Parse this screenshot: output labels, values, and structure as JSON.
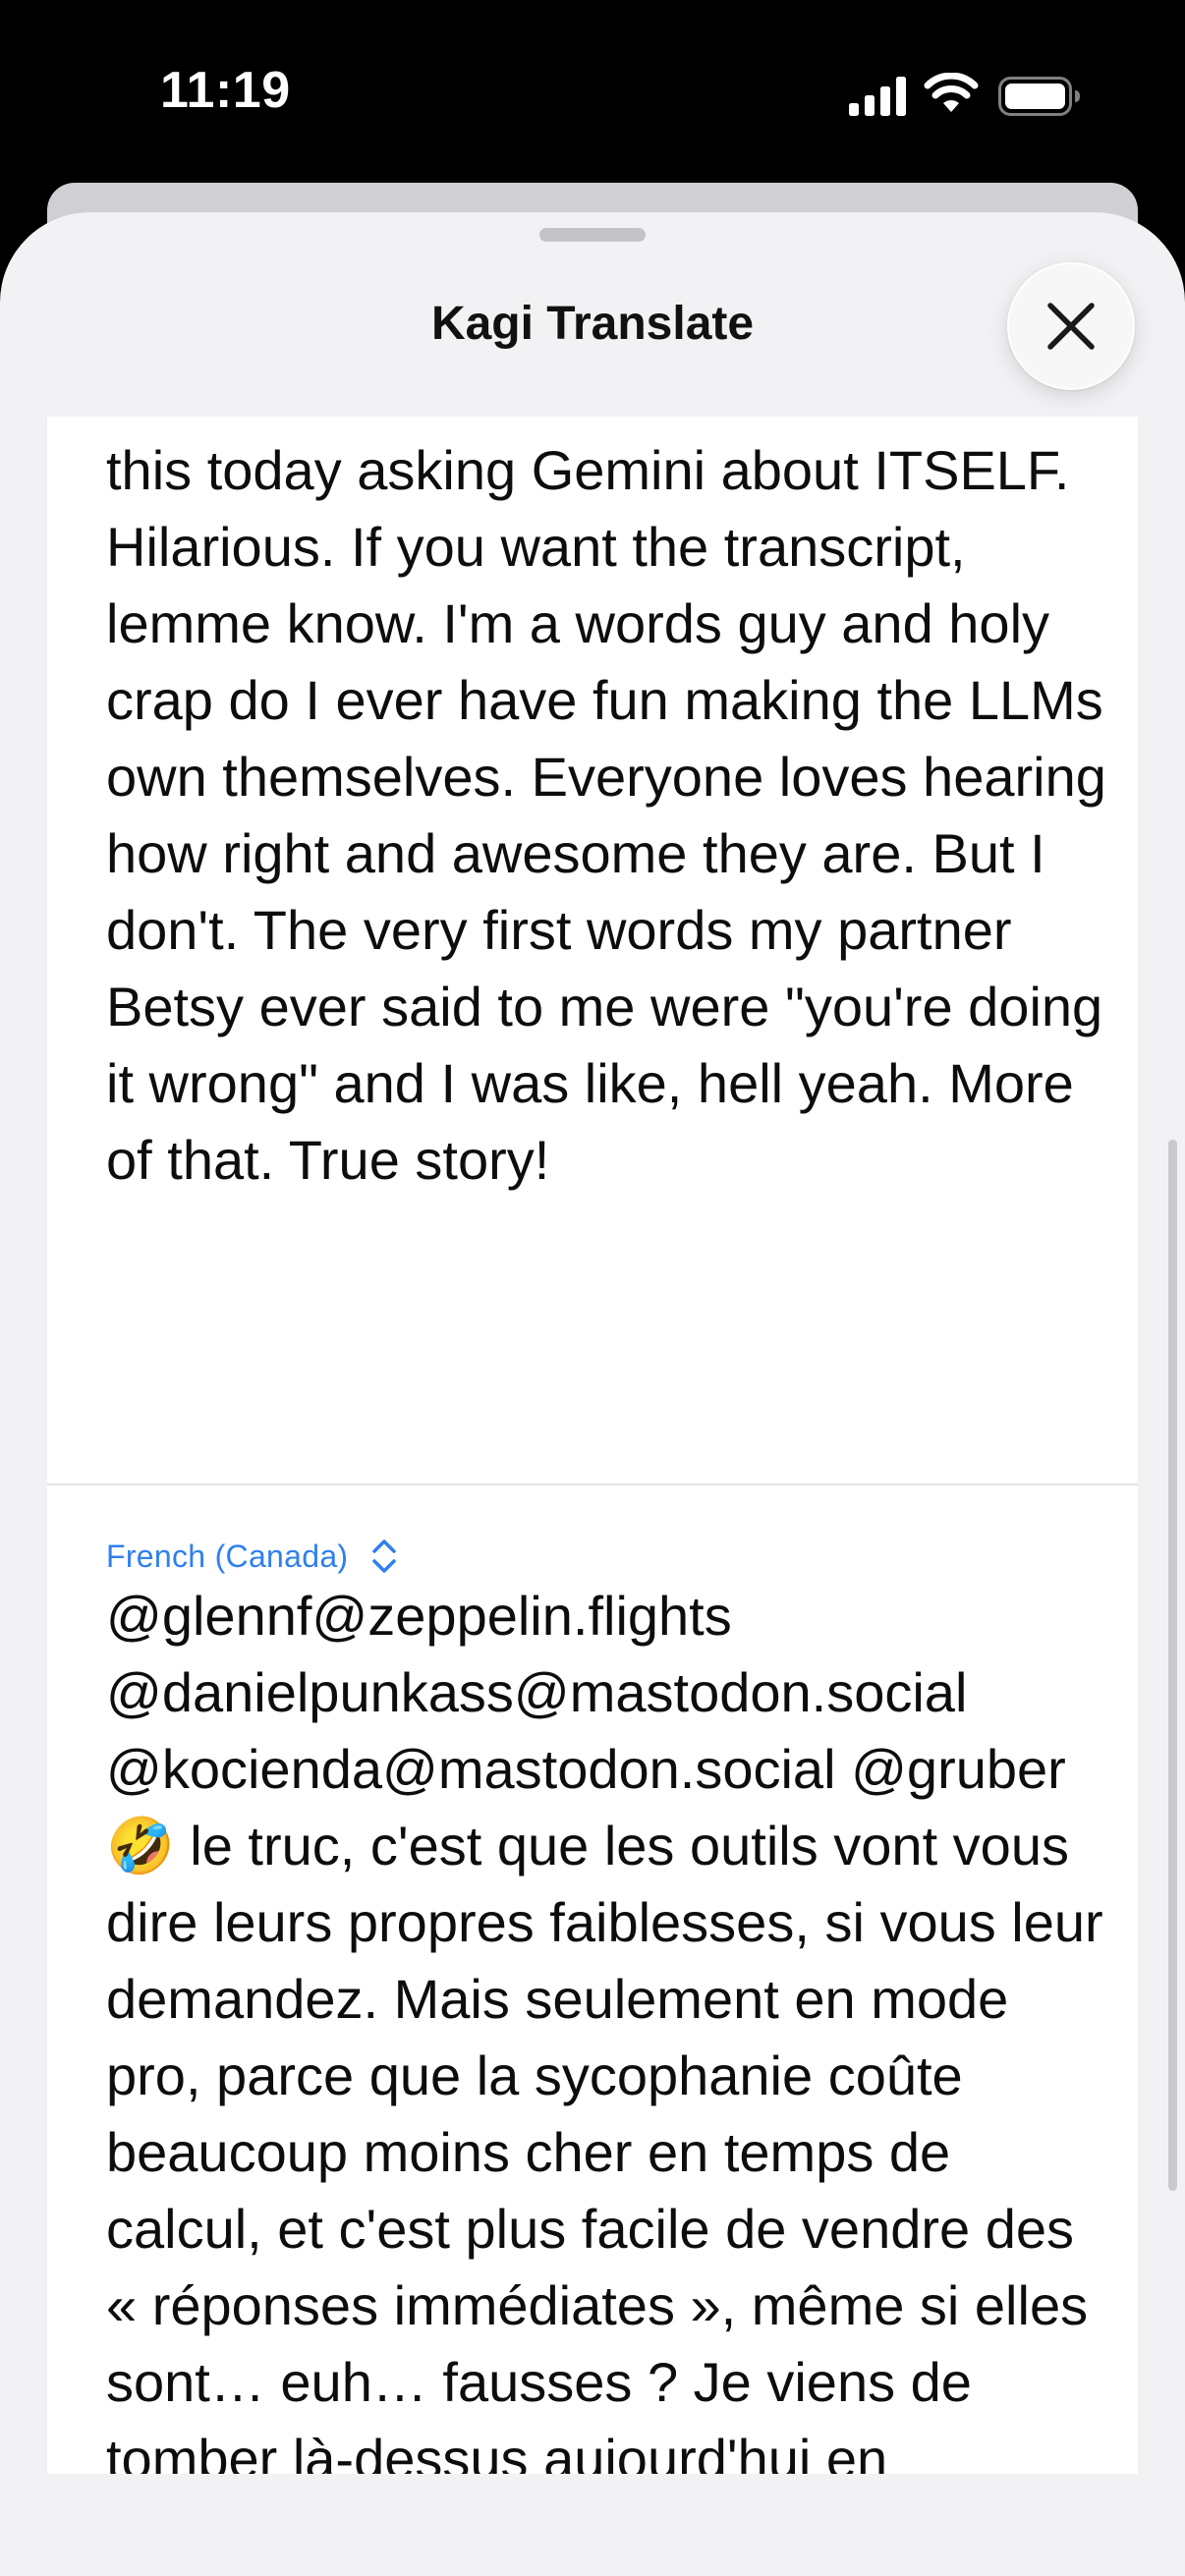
{
  "status_bar": {
    "time": "11:19"
  },
  "sheet": {
    "title": "Kagi Translate",
    "close_icon": "close-icon"
  },
  "source": {
    "text": "this today asking Gemini about ITSELF. Hilarious. If you want the transcript, lemme know. I'm a words guy and holy crap do I ever have fun making the LLMs own themselves. Everyone loves hearing how right and awesome they are. But I don't. The very first words my partner Betsy ever said to me were \"you're doing it wrong\" and I was like, hell yeah. More of that. True story!"
  },
  "translation": {
    "language": "French (Canada)",
    "language_icon": "chevron-updown-icon",
    "text": "@glennf@zeppelin.flights @danielpunkass@mastodon.social @kocienda@mastodon.social @gruber 🤣 le truc, c'est que les outils vont vous dire leurs propres faiblesses, si vous leur demandez. Mais seulement en mode pro, parce que la sycophanie coûte beaucoup moins cher en temps de calcul, et c'est plus facile de vendre des « réponses immédiates », même si elles sont… euh… fausses ? Je viens de tomber là-dessus aujourd'hui en interrogeant Gemini sur LUI-MÊME. Hilarant. Si vous voulez la"
  },
  "colors": {
    "accent": "#2f80ed",
    "sheet_background": "#f2f2f4",
    "card_background": "#ffffff",
    "status_bar_background": "#000000"
  }
}
